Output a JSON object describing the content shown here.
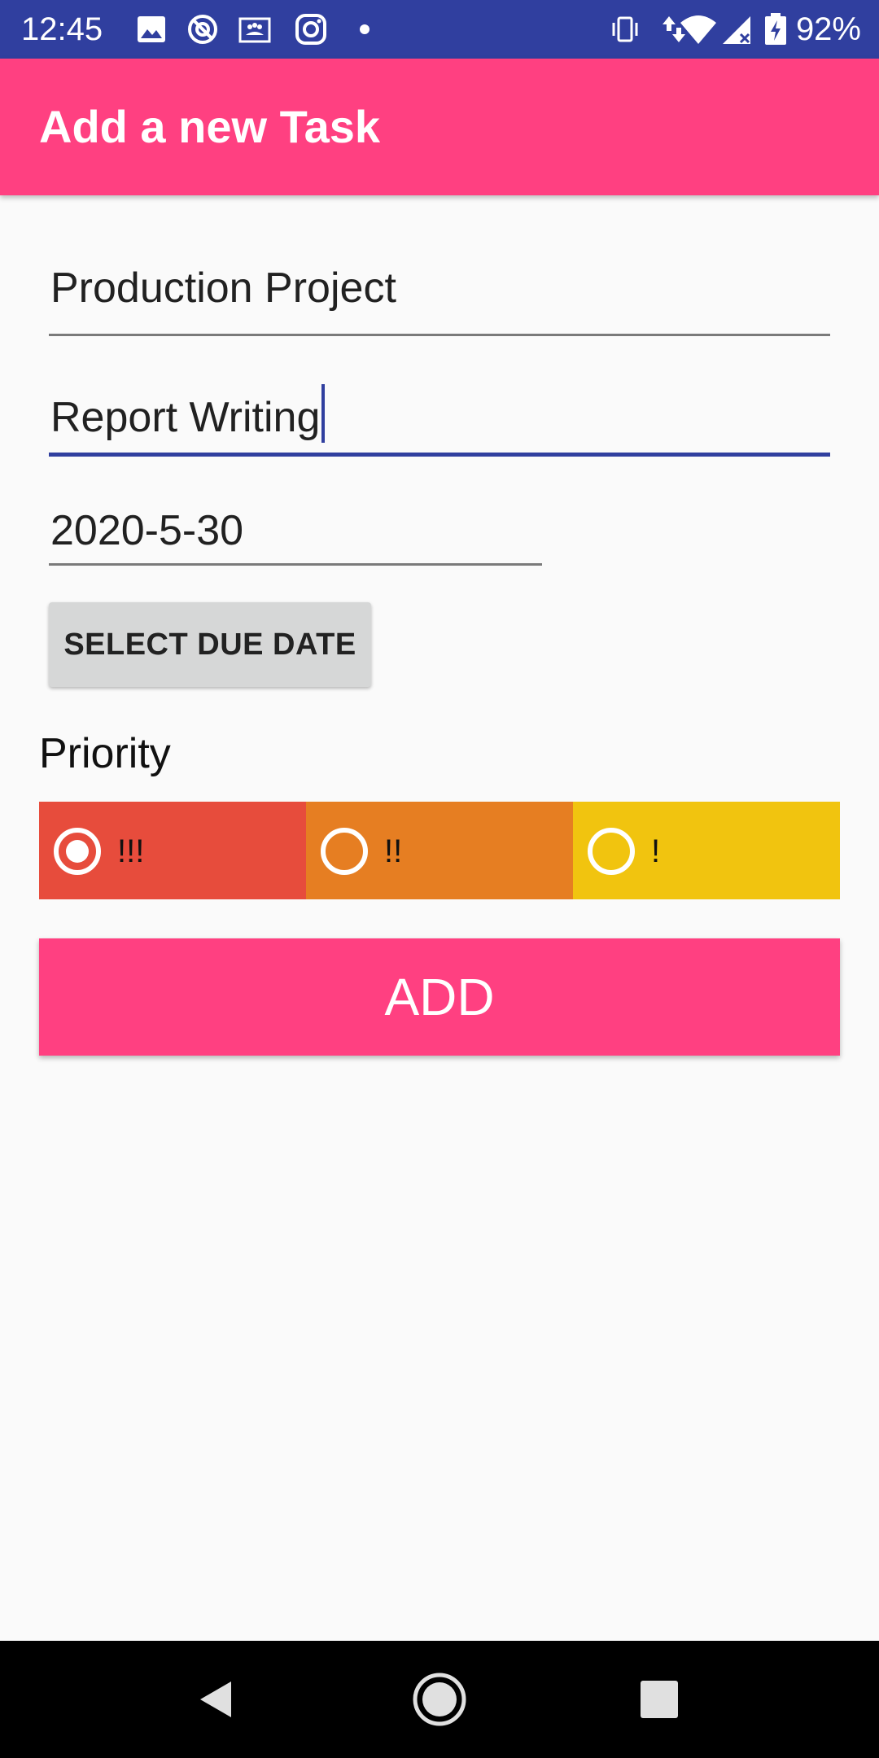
{
  "status_bar": {
    "time": "12:45",
    "battery": "92%",
    "icons": [
      "image-icon",
      "vpn-icon",
      "contacts-card-icon",
      "instagram-icon",
      "dot-icon",
      "vibrate-icon",
      "data-arrows-icon",
      "wifi-icon",
      "signal-icon",
      "battery-icon"
    ]
  },
  "app_bar": {
    "title": "Add a new Task"
  },
  "form": {
    "project_value": "Production Project",
    "task_value": "Report Writing",
    "date_value": "2020-5-30",
    "select_due_date_label": "SELECT DUE DATE",
    "priority_label": "Priority",
    "priorities": [
      {
        "label": "!!!",
        "checked": true,
        "color": "#e74c3c"
      },
      {
        "label": "!!",
        "checked": false,
        "color": "#e67e22"
      },
      {
        "label": "!",
        "checked": false,
        "color": "#f1c40f"
      }
    ],
    "add_label": "ADD"
  },
  "colors": {
    "primary": "#303f9f",
    "accent": "#ff4081"
  },
  "nav_bar": {
    "icons": [
      "back-icon",
      "home-icon",
      "recents-icon"
    ]
  }
}
